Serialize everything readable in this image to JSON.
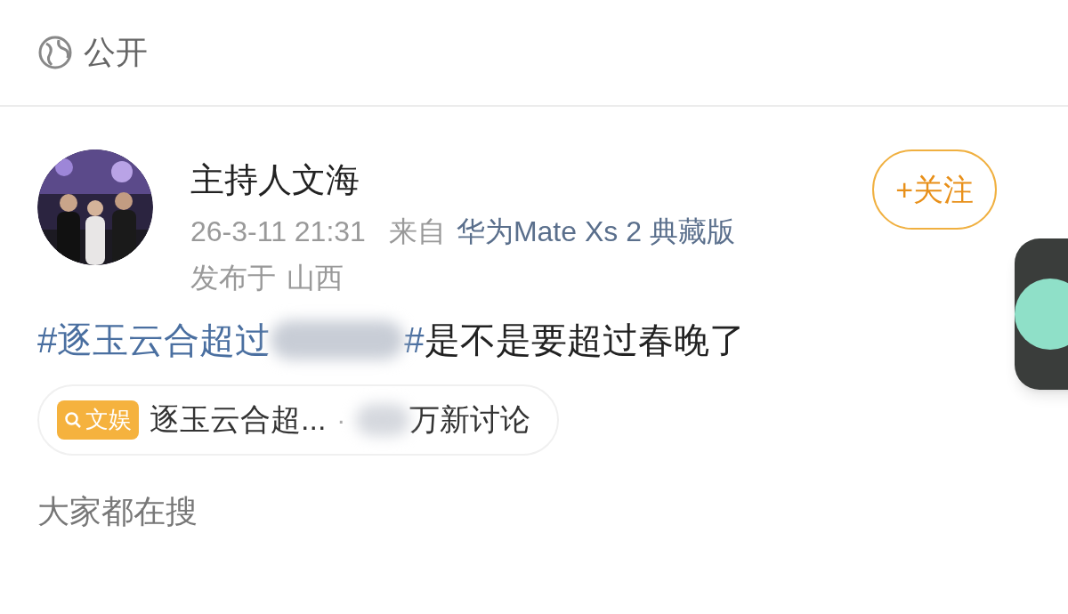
{
  "visibility": {
    "label": "公开"
  },
  "post": {
    "author": "主持人文海",
    "follow_button": "+关注",
    "time": "26-3-11 21:31",
    "source_prefix": "来自",
    "device": "华为Mate Xs 2 典藏版",
    "location_prefix": "发布于",
    "location": "山西",
    "content": [
      {
        "kind": "hashtag",
        "text": "#逐玉云合超过"
      },
      {
        "kind": "redacted"
      },
      {
        "kind": "hashtag",
        "text": "#"
      },
      {
        "kind": "text",
        "text": "是不是要超过春晚了"
      }
    ],
    "topic_card": {
      "tag": "文娱",
      "title": "逐玉云合超...",
      "separator": "·",
      "count_suffix": "万新讨论"
    }
  },
  "section_title": "大家都在搜"
}
